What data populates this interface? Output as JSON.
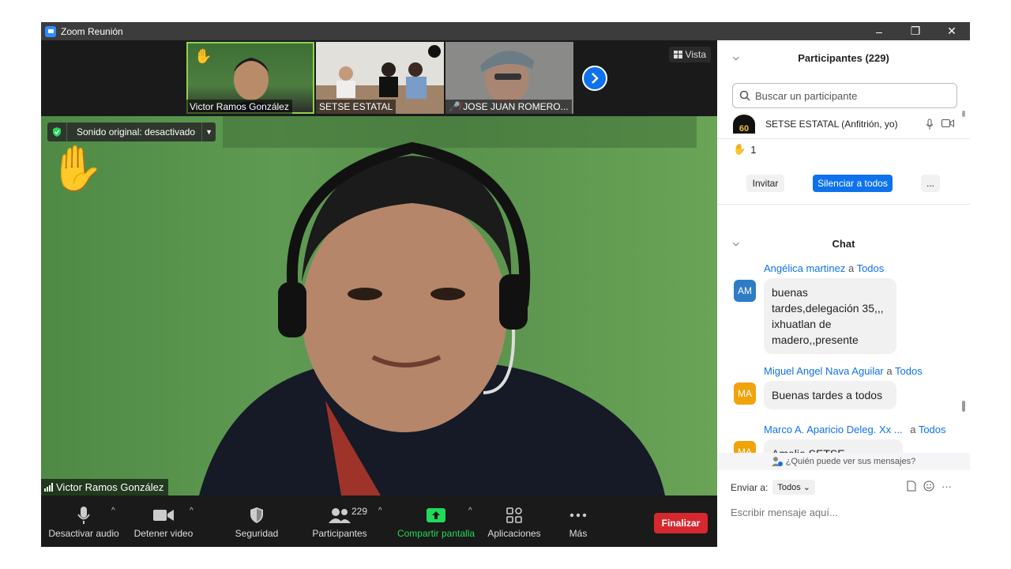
{
  "window": {
    "title": "Zoom Reunión",
    "minimize": "–",
    "restore": "❐",
    "close": "✕"
  },
  "thumbnails": [
    {
      "name": "Victor Ramos González",
      "muted": false
    },
    {
      "name": "SETSE ESTATAL",
      "muted": false
    },
    {
      "name": "JOSE JUAN ROMERO...",
      "muted": true
    }
  ],
  "view_button": "Vista",
  "sound_original": "Sonido original: desactivado",
  "speaker_name": "Victor Ramos González",
  "toolbar": {
    "audio": "Desactivar audio",
    "video": "Detener video",
    "security": "Seguridad",
    "participants": "Participantes",
    "participants_count": "229",
    "share": "Compartir pantalla",
    "apps": "Aplicaciones",
    "more": "Más",
    "end": "Finalizar"
  },
  "participants_panel": {
    "title": "Participantes (229)",
    "search_placeholder": "Buscar un participante",
    "self_row": "SETSE ESTATAL (Anfitrión, yo)",
    "raised_hands": "1",
    "invite": "Invitar",
    "mute_all": "Silenciar a todos",
    "more": "..."
  },
  "chat": {
    "title": "Chat",
    "messages": [
      {
        "initials": "AM",
        "sender": "Angélica martinez",
        "to": "a",
        "audience": "Todos",
        "text": "buenas tardes,delegación 35,,, ixhuatlan de madero,,presente",
        "color": "#2e7cc4"
      },
      {
        "initials": "MA",
        "sender": "Miguel Angel Nava Aguilar",
        "to": "a",
        "audience": "Todos",
        "text": "Buenas tardes a todos",
        "color": "#f0a30a"
      },
      {
        "initials": "MA",
        "sender": "Marco A. Aparicio Deleg. Xx ...",
        "to": "a",
        "audience": "Todos",
        "text": "Amelie SETSE",
        "color": "#f0a30a"
      }
    ],
    "who_can_see": "¿Quién puede ver sus mensajes?",
    "send_to_label": "Enviar a:",
    "send_to_value": "Todos",
    "input_placeholder": "Escribir mensaje aquí..."
  },
  "colors": {
    "accent": "#0e72ed",
    "end": "#d7282f",
    "share": "#23d959",
    "active_border": "#8fd14f"
  }
}
